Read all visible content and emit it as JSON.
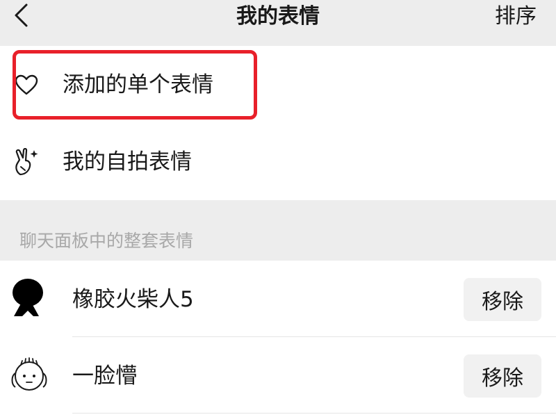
{
  "nav": {
    "title": "我的表情",
    "sort_label": "排序",
    "back_icon": "chevron-left-icon"
  },
  "my_items": [
    {
      "label": "添加的单个表情",
      "icon": "heart-outline-icon"
    },
    {
      "label": "我的自拍表情",
      "icon": "victory-hand-sparkle-icon"
    }
  ],
  "highlight_color": "#e8202a",
  "panel_section": {
    "header": "聊天面板中的整套表情",
    "packs": [
      {
        "name": "橡胶火柴人5",
        "remove_label": "移除",
        "icon": "black-stickman-icon"
      },
      {
        "name": "一脸懵",
        "remove_label": "移除",
        "icon": "doodle-face-icon"
      }
    ]
  }
}
